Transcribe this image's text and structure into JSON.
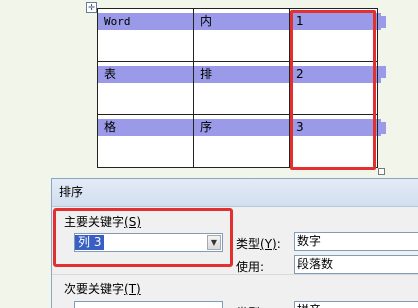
{
  "table": {
    "move_handle_glyph": "✛",
    "rows": [
      [
        "Word",
        "内",
        "1"
      ],
      [
        "表",
        "排",
        "2"
      ],
      [
        "格",
        "序",
        "3"
      ]
    ]
  },
  "dialog": {
    "title": "排序",
    "primary_key": {
      "label": "主要关键字",
      "accel": "(S)",
      "selected_value": "列 3",
      "arrow": "▼"
    },
    "type_label": "类型",
    "type_accel": "(Y)",
    "type_value": "数字",
    "use_label": "使用:",
    "use_value": "段落数",
    "secondary_key": {
      "label": "次要关键字",
      "accel": "(T)"
    },
    "secondary_type_label": "类型",
    "secondary_type_value": "拼音"
  },
  "colors": {
    "selection": "#9a9ae8",
    "highlight_border": "#e23030",
    "select_value_bg": "#3a5fc4"
  }
}
